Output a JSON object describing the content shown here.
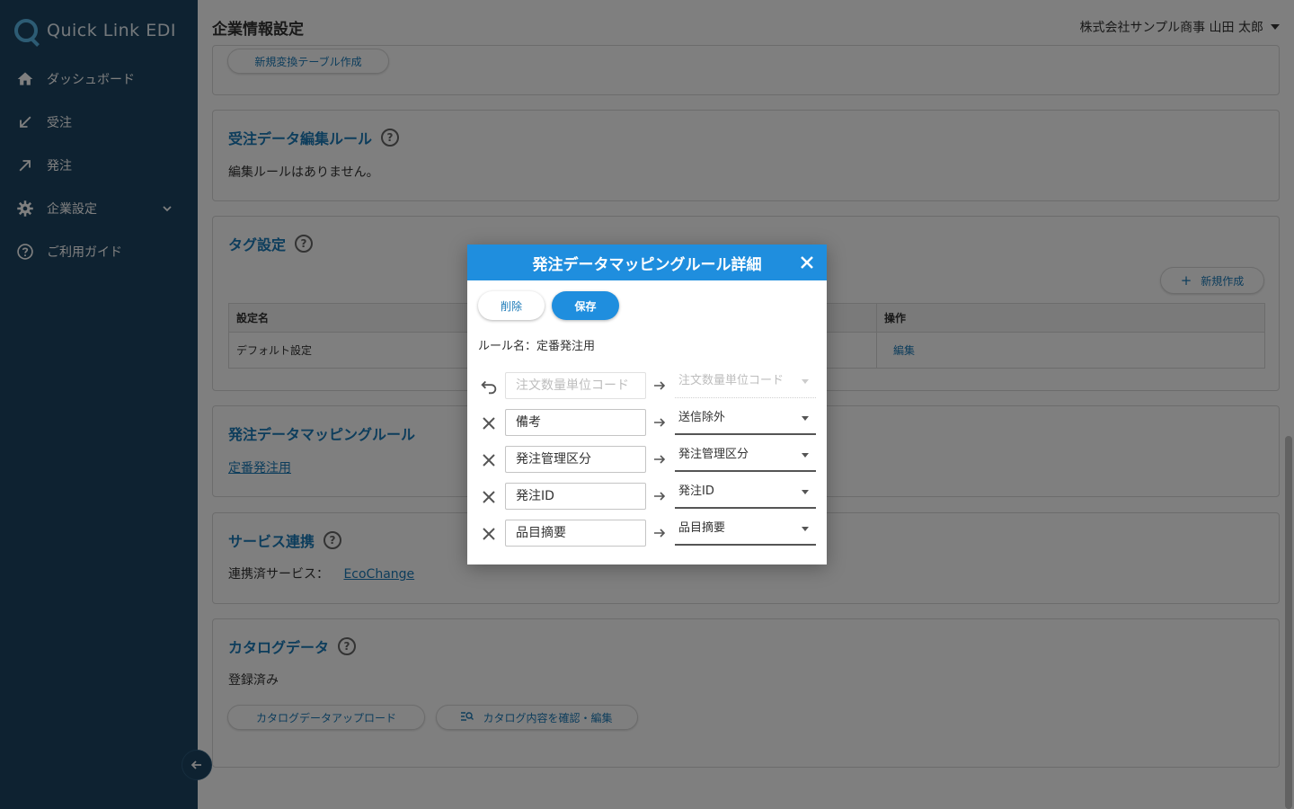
{
  "app": {
    "name": "Quick Link EDI"
  },
  "sidebar": {
    "items": [
      {
        "label": "ダッシュボード",
        "icon": "home-icon"
      },
      {
        "label": "受注",
        "icon": "arrow-down-left-icon"
      },
      {
        "label": "発注",
        "icon": "arrow-up-right-icon"
      },
      {
        "label": "企業設定",
        "icon": "gear-icon"
      },
      {
        "label": "ご利用ガイド",
        "icon": "help-icon"
      }
    ]
  },
  "header": {
    "title": "企業情報設定",
    "user": "株式会社サンプル商事 山田 太郎"
  },
  "main": {
    "conversion": {
      "new_button": "新規変換テーブル作成"
    },
    "order_edit_rules": {
      "title": "受注データ編集ルール",
      "empty_text": "編集ルールはありません。"
    },
    "tags": {
      "title": "タグ設定",
      "new_button": "新規作成",
      "columns": [
        "設定名",
        "操作"
      ],
      "rows": [
        {
          "name": "デフォルト設定",
          "action": "編集"
        }
      ]
    },
    "order_mapping": {
      "title": "発注データマッピングルール",
      "link": "定番発注用"
    },
    "service": {
      "title": "サービス連携",
      "label": "連携済サービス：",
      "link": "EcoChange"
    },
    "catalog": {
      "title": "カタログデータ",
      "status": "登録済み",
      "upload_button": "カタログデータアップロード",
      "view_button": "カタログ内容を確認・編集"
    }
  },
  "modal": {
    "title": "発注データマッピングルール詳細",
    "delete_label": "削除",
    "save_label": "保存",
    "rule_name": "ルール名：定番発注用",
    "rows": [
      {
        "source": "注文数量単位コード",
        "target": "注文数量単位コード",
        "disabled": true
      },
      {
        "source": "備考",
        "target": "送信除外",
        "disabled": false
      },
      {
        "source": "発注管理区分",
        "target": "発注管理区分",
        "disabled": false
      },
      {
        "source": "発注ID",
        "target": "発注ID",
        "disabled": false
      },
      {
        "source": "品目摘要",
        "target": "品目摘要",
        "disabled": false
      }
    ]
  },
  "colors": {
    "sidebar": "#1c4563",
    "accent": "#1f8ede",
    "link": "#1b7ab8"
  }
}
